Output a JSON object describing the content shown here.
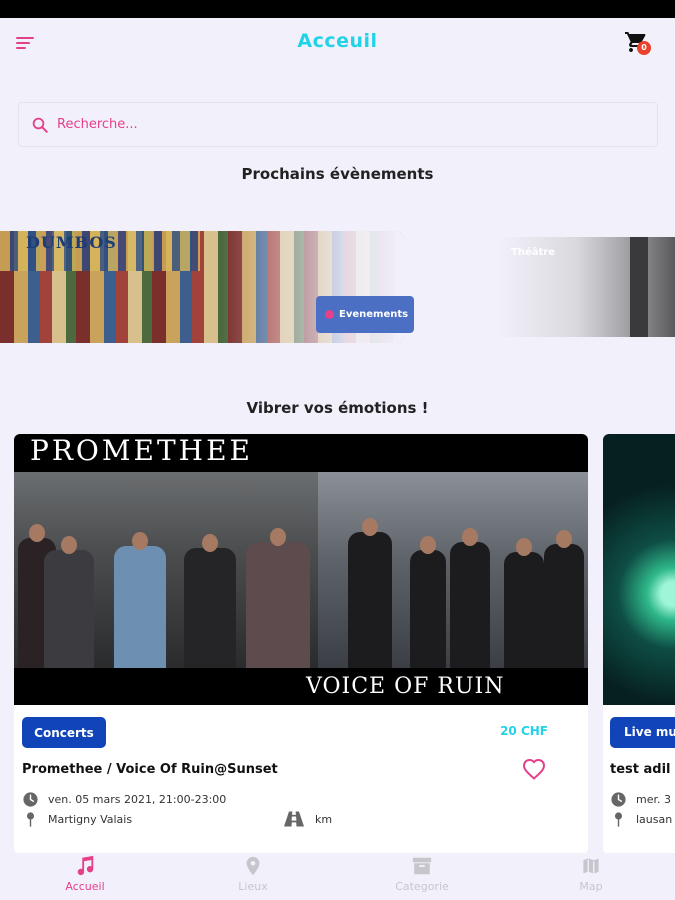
{
  "header": {
    "title": "Acceuil",
    "cart_count": "0"
  },
  "search": {
    "placeholder": "Recherche..."
  },
  "sections": {
    "upcoming": "Prochains évènements",
    "emotions": "Vibrer vos émotions !"
  },
  "banners": [
    {
      "chip_label": "Evenements",
      "poster_text": "DUMBOS"
    },
    {
      "label": "Théâtre"
    }
  ],
  "cards": [
    {
      "category": "Concerts",
      "price": "20 CHF",
      "title": "Promethee / Voice Of Ruin@Sunset",
      "date": "ven. 05 mars 2021, 21:00-23:00",
      "location": "Martigny Valais",
      "distance": "km",
      "image_top_text": "PROMETHEE",
      "image_bottom_text": "VOICE OF RUIN"
    },
    {
      "category": "Live mus",
      "title": "test adil",
      "date": "mer. 3",
      "location": "lausan"
    }
  ],
  "tabs": [
    {
      "label": "Accueil",
      "icon": "music-note-icon",
      "active": true
    },
    {
      "label": "Lieux",
      "icon": "map-pin-icon",
      "active": false
    },
    {
      "label": "Categorie",
      "icon": "archive-box-icon",
      "active": false
    },
    {
      "label": "Map",
      "icon": "map-icon",
      "active": false
    }
  ],
  "colors": {
    "accent": "#e5408a",
    "title_cyan": "#22d3e8",
    "chip_blue": "#1144b8",
    "background": "#f2f1fb"
  }
}
